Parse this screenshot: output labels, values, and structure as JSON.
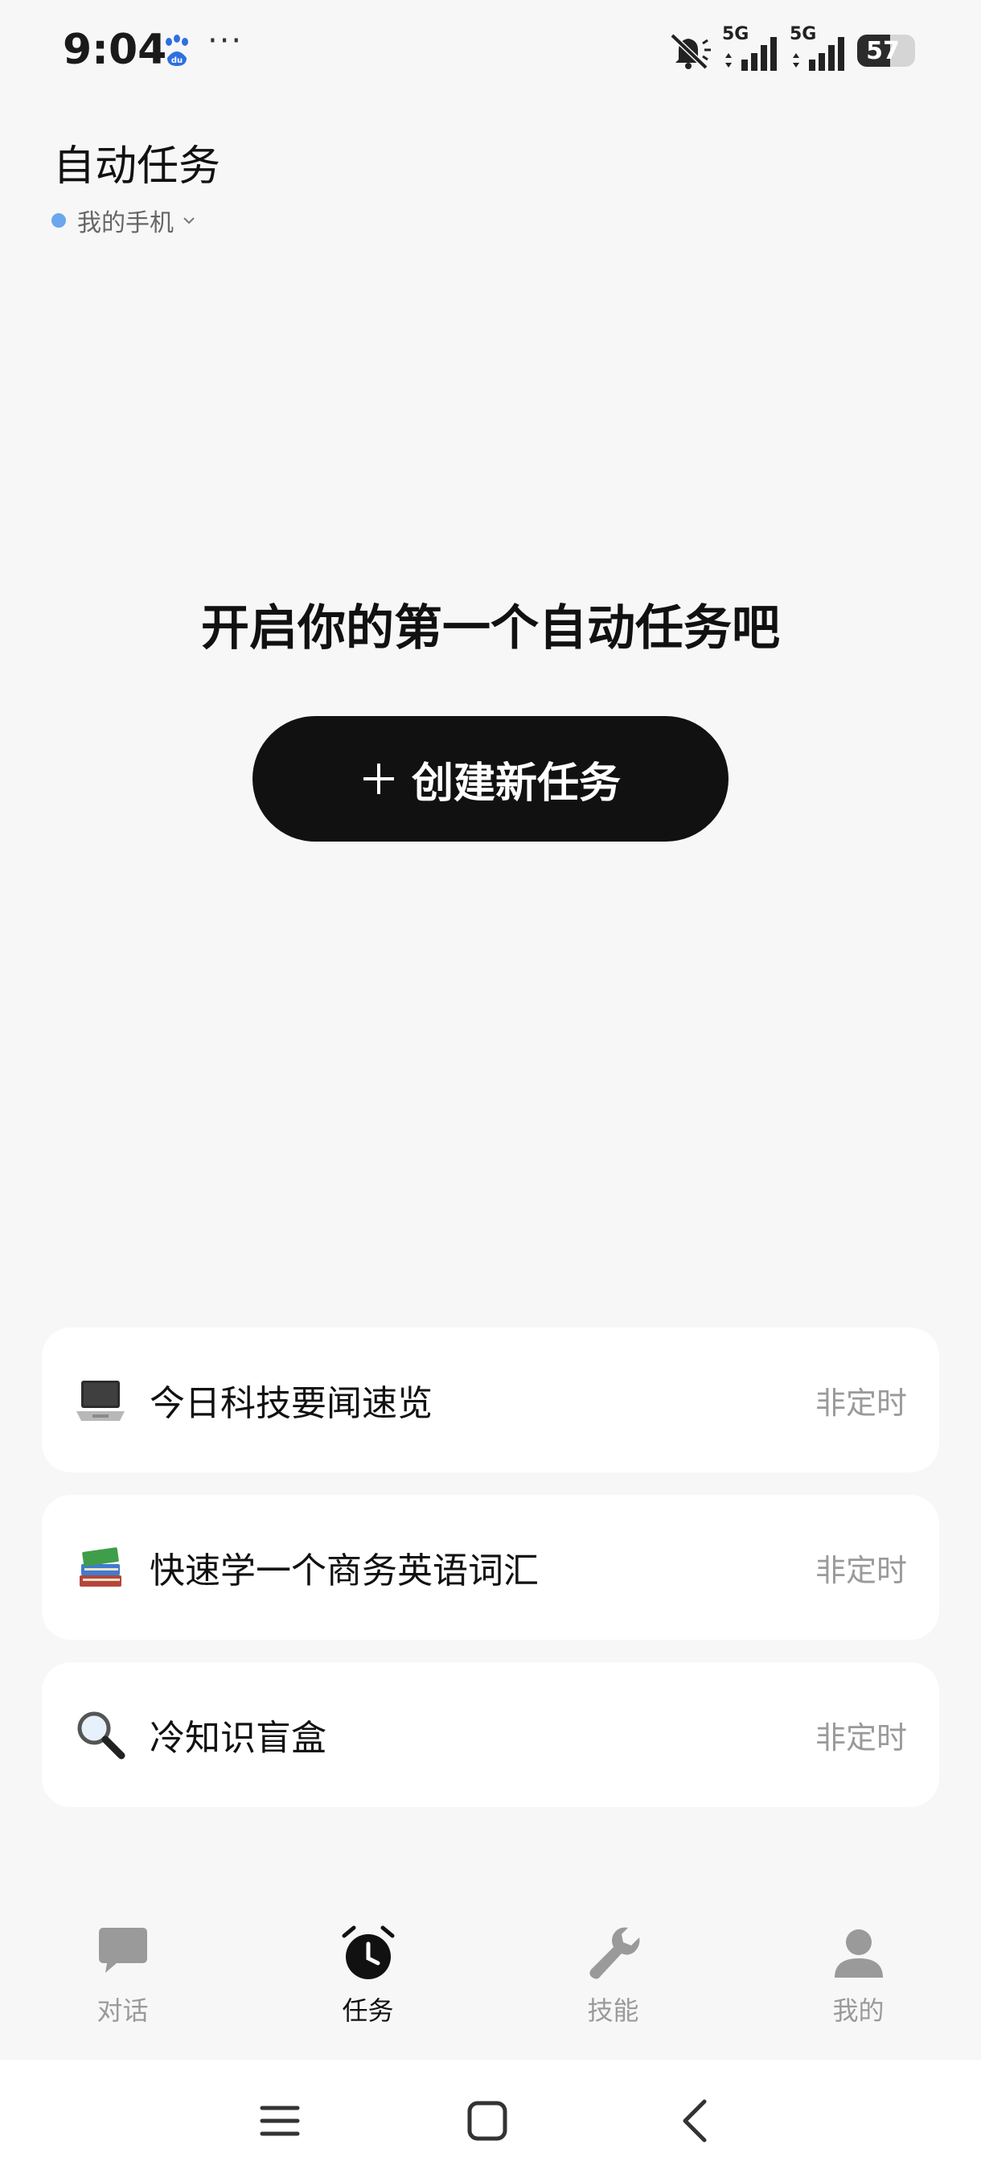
{
  "status_bar": {
    "time": "9:04",
    "more": "···",
    "signal_1": "5G",
    "signal_2": "5G",
    "battery_percent": 57,
    "battery_label": "57"
  },
  "header": {
    "title": "自动任务",
    "device_label": "我的手机",
    "device_dot_color": "#6aa7ec"
  },
  "empty_state": {
    "title": "开启你的第一个自动任务吧",
    "button_label": "创建新任务"
  },
  "tasks": [
    {
      "icon": "laptop-icon",
      "title": "今日科技要闻速览",
      "schedule": "非定时"
    },
    {
      "icon": "books-icon",
      "title": "快速学一个商务英语词汇",
      "schedule": "非定时"
    },
    {
      "icon": "magnifier-icon",
      "title": "冷知识盲盒",
      "schedule": "非定时"
    }
  ],
  "tab_bar": {
    "active_color": "#111111",
    "inactive_color": "#9a9a9a",
    "tabs": [
      {
        "label": "对话",
        "icon": "chat-icon",
        "active": false
      },
      {
        "label": "任务",
        "icon": "alarm-clock-icon",
        "active": true
      },
      {
        "label": "技能",
        "icon": "wrench-icon",
        "active": false
      },
      {
        "label": "我的",
        "icon": "person-icon",
        "active": false
      }
    ]
  }
}
